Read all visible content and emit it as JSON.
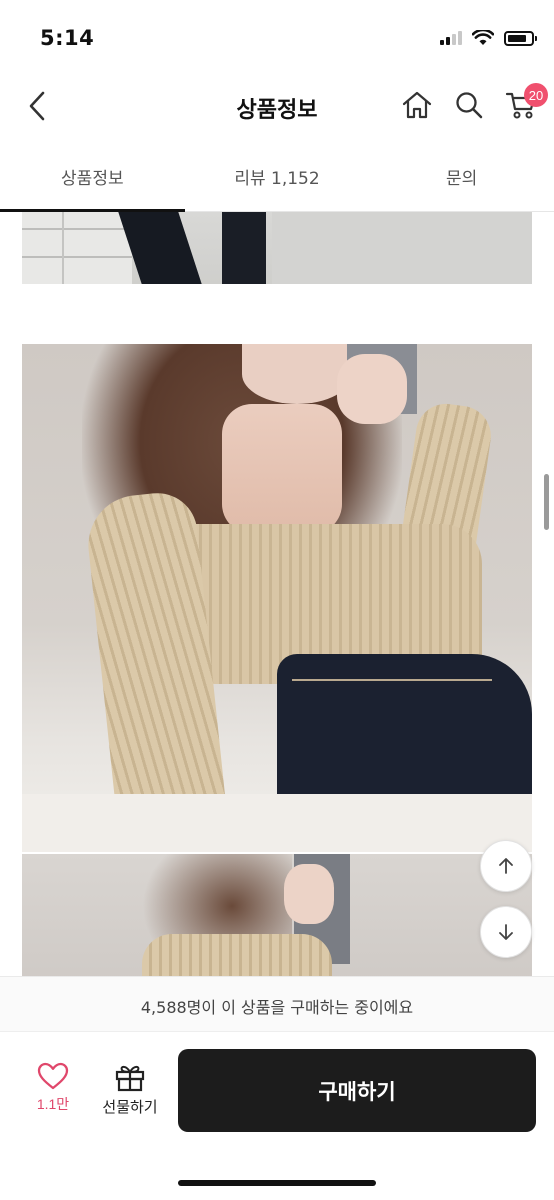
{
  "status_bar": {
    "time": "5:14"
  },
  "header": {
    "title": "상품정보",
    "cart_count": "20",
    "icons": [
      "back-chevron-icon",
      "home-icon",
      "search-icon",
      "cart-icon"
    ]
  },
  "tabs": [
    {
      "label": "상품정보",
      "active": true
    },
    {
      "label": "리뷰 1,152",
      "active": false
    },
    {
      "label": "문의",
      "active": false
    }
  ],
  "content": {
    "images": [
      "product-photo-partial-top",
      "product-photo-model-sweater",
      "product-photo-partial-bottom"
    ]
  },
  "floating": {
    "icons": [
      "arrow-up-icon",
      "arrow-down-icon"
    ]
  },
  "banner": {
    "text": "4,588명이 이 상품을 구매하는 중이에요"
  },
  "bottom_bar": {
    "like_count": "1.1만",
    "gift_label": "선물하기",
    "buy_label": "구매하기"
  },
  "colors": {
    "accent_pink": "#f0506e",
    "like_pink": "#e0476b",
    "buy_button": "#1c1c1c"
  }
}
